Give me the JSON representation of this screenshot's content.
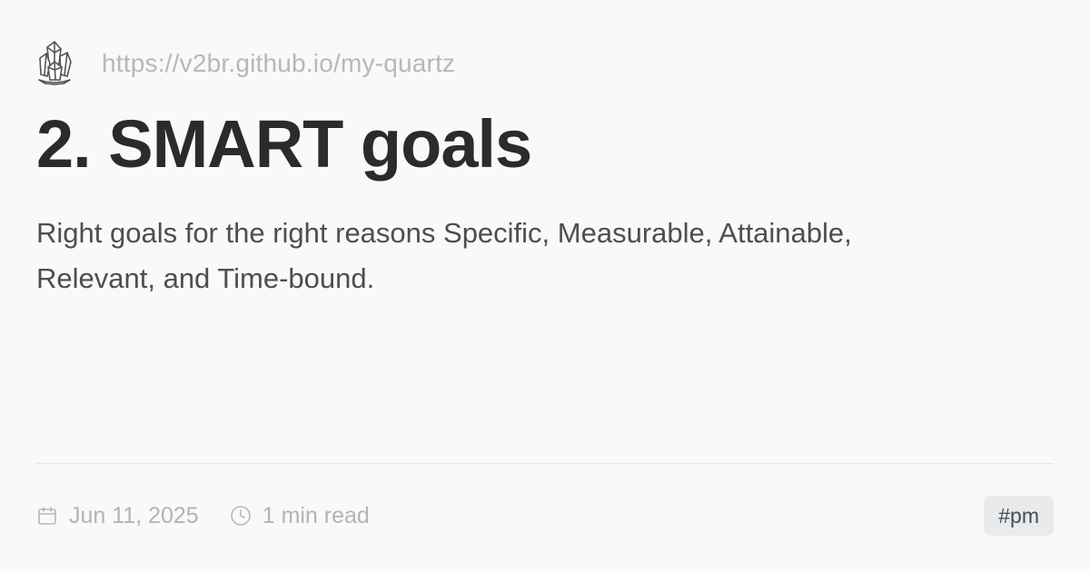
{
  "site": {
    "url": "https://v2br.github.io/my-quartz",
    "logo_icon": "quartz-crystal-icon"
  },
  "article": {
    "title": "2. SMART goals",
    "description": "Right goals for the right reasons Specific, Measurable, Attainable, Relevant, and Time-bound."
  },
  "footer": {
    "date": "Jun 11, 2025",
    "date_icon": "calendar-icon",
    "read_time": "1 min read",
    "read_time_icon": "clock-icon",
    "tag": "#pm"
  },
  "colors": {
    "background": "#faf8f8",
    "title": "#2b2b2b",
    "description": "#4e4e4e",
    "muted": "#b4b4b4",
    "tag_background": "#e9eaec",
    "tag_text": "#3f4f58"
  }
}
